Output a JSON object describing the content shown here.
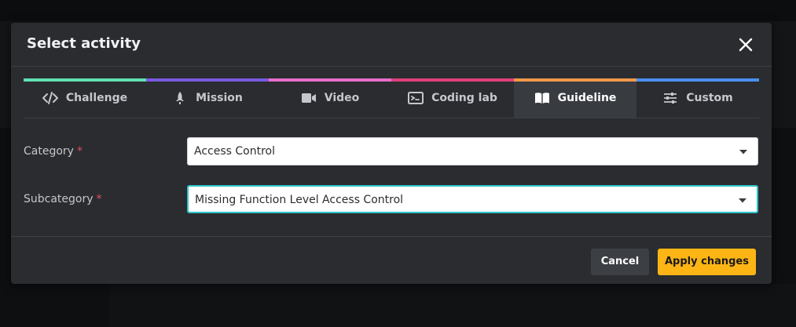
{
  "modal": {
    "title": "Select activity"
  },
  "tabs": [
    {
      "label": "Challenge",
      "icon": "code-icon",
      "color": "#5fe0b0"
    },
    {
      "label": "Mission",
      "icon": "rocket-icon",
      "color": "#7a5ae0"
    },
    {
      "label": "Video",
      "icon": "video-camera-icon",
      "color": "#e76dc9"
    },
    {
      "label": "Coding lab",
      "icon": "terminal-window-icon",
      "color": "#e0417a"
    },
    {
      "label": "Guideline",
      "icon": "open-book-icon",
      "color": "#f2984a",
      "active": true
    },
    {
      "label": "Custom",
      "icon": "sliders-icon",
      "color": "#4a8ff2"
    }
  ],
  "form": {
    "category": {
      "label": "Category",
      "required_mark": "*",
      "value": "Access Control"
    },
    "subcategory": {
      "label": "Subcategory",
      "required_mark": "*",
      "value": "Missing Function Level Access Control"
    }
  },
  "footer": {
    "cancel_label": "Cancel",
    "apply_label": "Apply changes"
  },
  "colors": {
    "accent_focus": "#2fc4c9",
    "primary_button": "#fdb515",
    "required": "#e0505e"
  }
}
